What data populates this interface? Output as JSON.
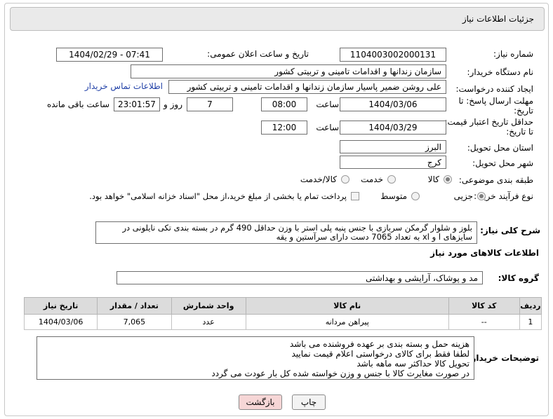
{
  "header": {
    "title": "جزئیات اطلاعات نیاز"
  },
  "fields": {
    "need_number": {
      "label": "شماره نیاز:",
      "value": "1104003002000131"
    },
    "announce_datetime": {
      "label": "تاریخ و ساعت اعلان عمومی:",
      "value": "1404/02/29 - 07:41"
    },
    "buyer_org": {
      "label": "نام دستگاه خریدار:",
      "value": "سازمان زندانها و اقدامات تامینی و تربیتی کشور"
    },
    "requester": {
      "label": "ایجاد کننده درخواست:",
      "value": "علی روشن ضمیر پاسیار سازمان زندانها و اقدامات تامینی و تربیتی کشور",
      "contact_link": "اطلاعات تماس خریدار"
    },
    "reply_deadline": {
      "label_line1": "مهلت ارسال پاسخ: تا",
      "label_line2": "تاریخ:",
      "date": "1404/03/06",
      "time_label": "ساعت",
      "time": "08:00",
      "days": "7",
      "days_label": "روز و",
      "remaining": "23:01:57",
      "remaining_label": "ساعت باقی مانده"
    },
    "price_validity": {
      "label_line1": "حداقل تاریخ اعتبار قیمت:",
      "label_line2": "تا تاریخ:",
      "date": "1404/03/29",
      "time_label": "ساعت",
      "time": "12:00"
    },
    "province": {
      "label": "استان محل تحویل:",
      "value": "البرز"
    },
    "city": {
      "label": "شهر محل تحویل:",
      "value": "کرج"
    },
    "category": {
      "label": "طبقه بندی موضوعی:",
      "options": [
        "کالا",
        "خدمت",
        "کالا/خدمت"
      ],
      "selected": "کالا"
    },
    "process_type": {
      "label": "نوع فرآیند خرید :",
      "options": [
        "جزیی",
        "متوسط"
      ],
      "checkbox_text": "پرداخت تمام یا بخشی از مبلغ خرید،از محل \"اسناد خزانه اسلامی\" خواهد بود."
    }
  },
  "description": {
    "label": "شرح کلی نیاز:",
    "text": "بلوز و شلوار گرمکن سربازی با جنس پنبه پلی استر با وزن حداقل 490 گرم در بسته بندی تکی نایلونی در سایزهای l و xl به تعداد 7065 دست دارای سرآستین و یقه"
  },
  "goods_section": {
    "title": "اطلاعات کالاهای مورد نیاز",
    "group_label": "گروه کالا:",
    "group_value": "مد و پوشاک، آرایشی و بهداشتی"
  },
  "table": {
    "headers": [
      "ردیف",
      "کد کالا",
      "نام کالا",
      "واحد شمارش",
      "تعداد / مقدار",
      "تاریخ نیاز"
    ],
    "rows": [
      [
        "1",
        "--",
        "پیراهن مردانه",
        "عدد",
        "7,065",
        "1404/03/06"
      ]
    ]
  },
  "buyer_notes": {
    "label": "توضیحات خریدار:",
    "lines": [
      "هزینه حمل و بسته بندی بر عهده فروشنده می باشد",
      "لطفا فقط برای کالای درخواستی اعلام قیمت نمایید",
      "تحویل کالا حداکثر سه ماهه باشد",
      "در صورت مغایرت کالا با جنس و وزن خواسته شده کل بار عودت می گردد"
    ]
  },
  "buttons": {
    "print": "چاپ",
    "back": "بازگشت"
  },
  "colors": {
    "header_bg": "#eaeaea",
    "link": "#1f3fa6",
    "back_button_bg": "#f6d6d6"
  }
}
